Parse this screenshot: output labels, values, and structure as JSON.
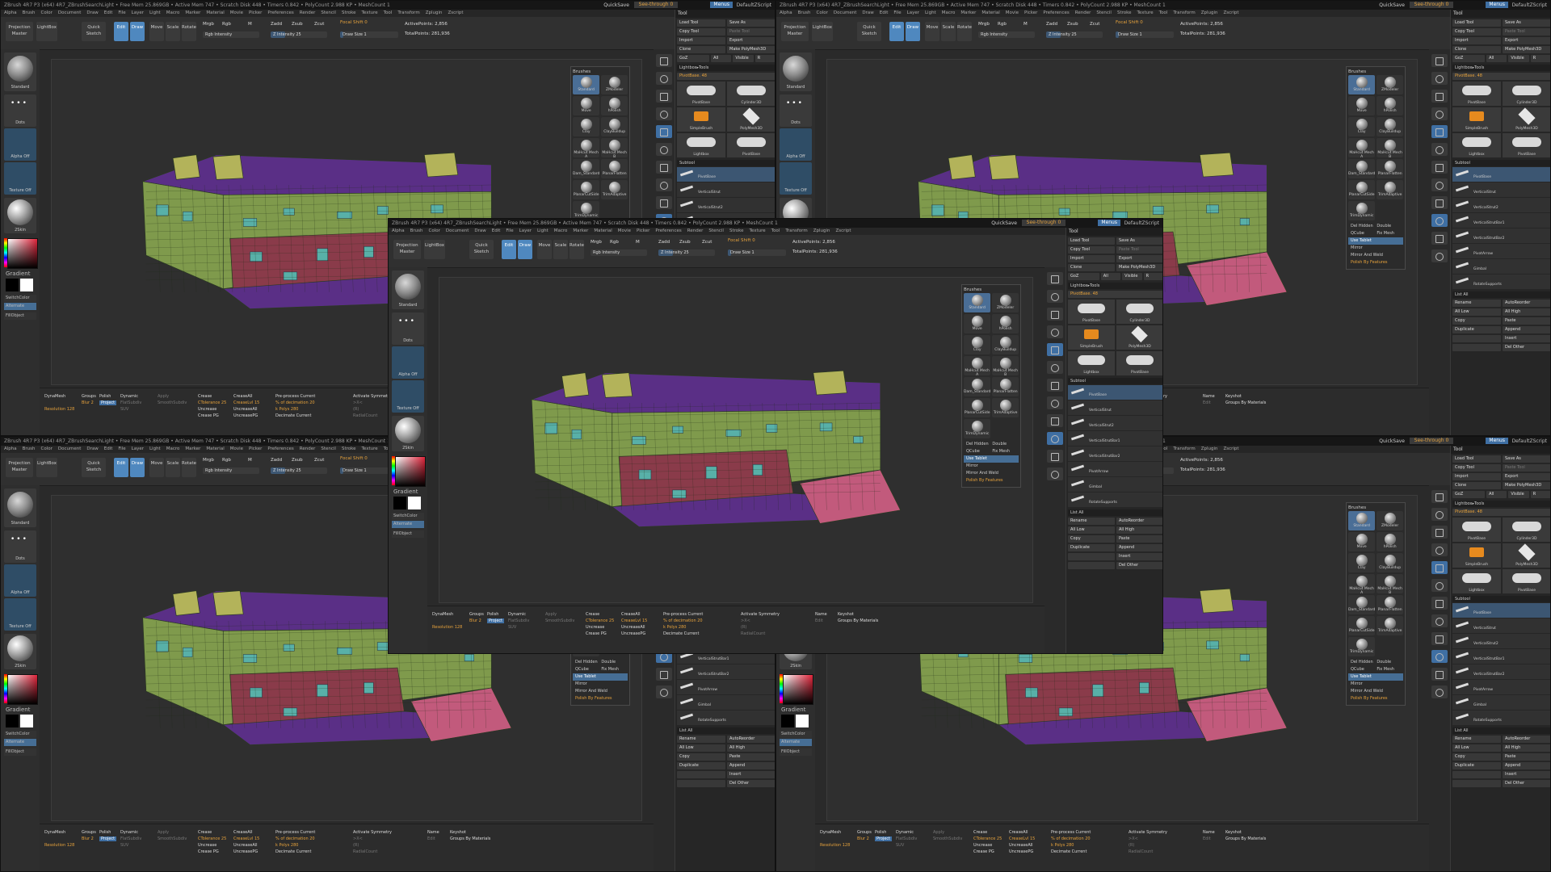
{
  "app": {
    "title": "ZBrush 4R7 P3 (x64)   4R7_ZBrushSearchLight   • Free Mem 25.869GB • Active Mem 747 • Scratch Disk 448 • Timers 0.842 • PolyCount 2.988 KP • MeshCount 1",
    "quicksave": "QuickSave",
    "see_through": "See-through 0",
    "menus": "Menus",
    "default_zscript": "DefaultZScript"
  },
  "menubar": [
    "Alpha",
    "Brush",
    "Color",
    "Document",
    "Draw",
    "Edit",
    "File",
    "Layer",
    "Light",
    "Macro",
    "Marker",
    "Material",
    "Movie",
    "Picker",
    "Preferences",
    "Render",
    "Stencil",
    "Stroke",
    "Texture",
    "Tool",
    "Transform",
    "Zplugin",
    "Zscript"
  ],
  "topshelf": {
    "projection_master": "Projection Master",
    "lightbox": "LightBox",
    "quick_sketch": "Quick Sketch",
    "edit": "Edit",
    "draw": "Draw",
    "move": "Move",
    "scale": "Scale",
    "rotate": "Rotate",
    "mrgb": "Mrgb",
    "rgb": "Rgb",
    "m": "M",
    "rgb_intensity": "Rgb Intensity",
    "zadd": "Zadd",
    "zsub": "Zsub",
    "zcut": "Zcut",
    "z_intensity": "Z Intensity 25",
    "focal_shift": "Focal Shift 0",
    "draw_size": "Draw Size 1",
    "dynamic": "Dynamic",
    "active_points": "ActivePoints: 2,856",
    "total_points": "TotalPoints: 281,936"
  },
  "leftshelf": {
    "brush": "Standard",
    "stroke": "Dots",
    "alpha": "Alpha Off",
    "texture": "Texture Off",
    "material": "2Skin",
    "gradient": "Gradient",
    "switch_color": "SwitchColor",
    "alternate": "Alternate",
    "fill_object": "FillObject"
  },
  "brushes": {
    "title": "Brushes",
    "items": [
      "Standard",
      "ZModeler",
      "Move",
      "hPolish",
      "Clay",
      "ClayBuildup",
      "MaHcut Mech A",
      "MaHcut Mech B",
      "Dam_Standard",
      "PlanarFlatten",
      "PlanarCutSide",
      "TrimAdaptive",
      "TrimDynamic"
    ],
    "props": [
      {
        "l": "Del Hidden",
        "r": "Double"
      },
      {
        "l": "QCube",
        "r": "Fix Mesh"
      },
      {
        "l": "Use Tablet",
        "r": "",
        "hi": true
      },
      {
        "l": "Mirror",
        "r": ""
      },
      {
        "l": "Mirror And Weld",
        "r": ""
      },
      {
        "l": "Polish By Features",
        "r": "",
        "or": true
      }
    ]
  },
  "tool": {
    "title": "Tool",
    "rows": [
      [
        "Load Tool",
        "Save As"
      ],
      [
        "Copy Tool",
        "Paste Tool"
      ],
      [
        "Import",
        "Export"
      ],
      [
        "Clone",
        "Make PolyMesh3D"
      ],
      [
        "GoZ",
        "All",
        "Visible",
        "R"
      ]
    ],
    "lightbox_tools": "Lightbox▸Tools",
    "current": "PivotBase. 48",
    "thumbs": [
      "PivotBase",
      "Cylinder3D",
      "SimpleBrush",
      "PolyMesh3D",
      "Lightbox",
      "PivotBase"
    ],
    "subtool": "Subtool",
    "subtools": [
      "PivotBase",
      "VerticalStrut",
      "VerticalStrut2",
      "VerticalStrutBar1",
      "VerticalStrutBar2",
      "PivotArrow",
      "Gimbal",
      "RotateSupports"
    ],
    "list_all": "List All",
    "bottom_rows": [
      [
        "Rename",
        "AutoReorder"
      ],
      [
        "All Low",
        "All High"
      ],
      [
        "Copy",
        "Paste"
      ],
      [
        "Duplicate",
        "Append"
      ],
      [
        "",
        "Insert"
      ],
      [
        "",
        "Del Other"
      ]
    ]
  },
  "bottomshelf": {
    "dynamesh": "DynaMesh",
    "resolution": "Resolution 128",
    "groups": "Groups",
    "polish": "Polish",
    "blur": "Blur 2",
    "project": "Project",
    "dynamic": "Dynamic",
    "apply": "Apply",
    "flat_subdiv": "FlatSubdiv",
    "smooth_subdiv": "SmoothSubdiv",
    "suv": "SUV",
    "crease": "Crease",
    "crease_all": "CreaseAll",
    "crease_tolerance": "CTolerance 25",
    "crease_lvl": "CreaseLvl 15",
    "uncrease": "Uncrease",
    "uncrease_all": "UncreaseAll",
    "crease_pg": "Crease PG",
    "uncrease_pg": "UncreasePG",
    "preprocess": "Pre-process Current",
    "decimation": "% of decimation 20",
    "kpolys": "k Polys 280",
    "decimate": "Decimate Current",
    "activate_symmetry": "Activate Symmetry",
    "x": ">X<",
    "y": ">Y<",
    "z": ">Z<",
    "m": ">M<",
    "r": "(R)",
    "radial_count": "RadialCount",
    "name": "Name",
    "keyshot": "Keyshot",
    "groups_by_materials": "Groups By Materials",
    "edit": "Edit"
  },
  "colors": {
    "accent": "#3f6fa3",
    "orange": "#e6a23c",
    "mesh_green": "#7f9a4c",
    "mesh_purple": "#5a2f86",
    "mesh_maroon": "#8a3b4a",
    "mesh_teal": "#58b0a8",
    "mesh_yellow": "#b3b35a"
  },
  "icons": [
    "gear-icon",
    "bpr-icon",
    "persp-icon",
    "floor-icon",
    "local-icon",
    "xyz-icon",
    "frame-icon",
    "move-icon",
    "scale-icon",
    "rotate-icon",
    "transp-icon",
    "solo-icon"
  ]
}
